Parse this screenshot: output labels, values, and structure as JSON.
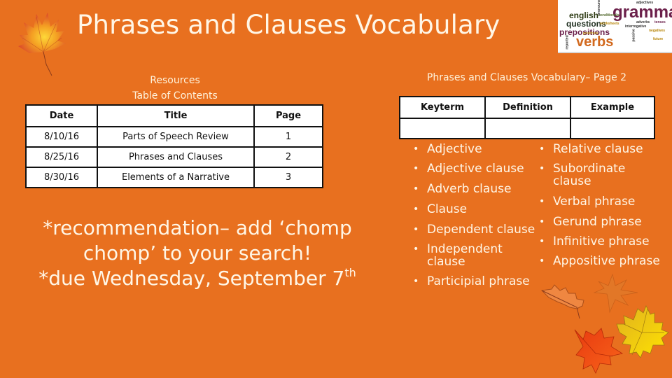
{
  "slide": {
    "title": "Phrases and Clauses Vocabulary",
    "background_color": "#E8701F"
  },
  "wordcloud": {
    "words": [
      "grammar",
      "english",
      "questions",
      "prepositions",
      "verbs",
      "adjectives",
      "conditionals",
      "adverbs",
      "interrogative",
      "worksheets",
      "positives",
      "negatives",
      "reported",
      "passive",
      "future",
      "tenses",
      "pronouns"
    ]
  },
  "toc": {
    "caption_line1": "Resources",
    "caption_line2": "Table of Contents",
    "headers": [
      "Date",
      "Title",
      "Page"
    ],
    "rows": [
      [
        "8/10/16",
        "Parts of Speech Review",
        "1"
      ],
      [
        "8/25/16",
        "Phrases and Clauses",
        "2"
      ],
      [
        "8/30/16",
        "Elements of a Narrative",
        "3"
      ]
    ]
  },
  "note": {
    "line1": "*recommendation– add ‘chomp",
    "line2": "chomp’ to your search!",
    "line3": "*due Wednesday, September 7",
    "line3_sup": "th"
  },
  "vocab": {
    "caption": "Phrases and Clauses Vocabulary– Page 2",
    "headers": [
      "Keyterm",
      "Definition",
      "Example"
    ],
    "row": [
      "",
      "",
      ""
    ],
    "bullet": "•",
    "terms_col1": [
      "Adjective",
      "Adjective clause",
      "Adverb clause",
      "Clause",
      "Dependent clause",
      "Independent clause",
      "Participial phrase"
    ],
    "terms_col2": [
      "Relative clause",
      "Subordinate clause",
      "Verbal phrase",
      "Gerund phrase",
      "Infinitive phrase",
      "Appositive phrase"
    ]
  },
  "icons": {
    "top_left": "maple-leaf-icon",
    "bottom_right": [
      "oak-leaf-icon",
      "faded-leaf-icon",
      "red-maple-leaf-icon",
      "yellow-maple-leaf-icon"
    ]
  }
}
